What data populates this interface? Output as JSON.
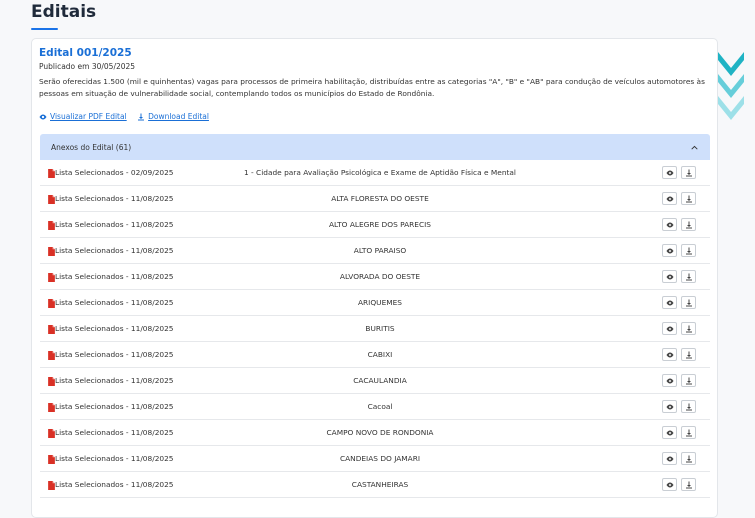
{
  "page": {
    "title": "Editais"
  },
  "edital": {
    "title": "Edital 001/2025",
    "published": "Publicado em 30/05/2025",
    "description": "Serão oferecidas 1.500 (mil e quinhentas) vagas para processos de primeira habilitação, distribuídas entre as categorias \"A\", \"B\" e \"AB\" para condução de veículos automotores às pessoas em situação de vulnerabilidade social, contemplando todos os municípios do Estado de Rondônia.",
    "view_pdf_label": "Visualizar PDF Edital",
    "download_label": "Download Edital"
  },
  "annexes": {
    "header": "Anexos do Edital (61)",
    "rows": [
      {
        "name": "Lista Selecionados - 02/09/2025",
        "desc": "1 - Cidade para Avaliação Psicológica e Exame de Aptidão Física e Mental"
      },
      {
        "name": "Lista Selecionados - 11/08/2025",
        "desc": "ALTA FLORESTA DO OESTE"
      },
      {
        "name": "Lista Selecionados - 11/08/2025",
        "desc": "ALTO ALEGRE DOS PARECIS"
      },
      {
        "name": "Lista Selecionados - 11/08/2025",
        "desc": "ALTO PARAISO"
      },
      {
        "name": "Lista Selecionados - 11/08/2025",
        "desc": "ALVORADA DO OESTE"
      },
      {
        "name": "Lista Selecionados - 11/08/2025",
        "desc": "ARIQUEMES"
      },
      {
        "name": "Lista Selecionados - 11/08/2025",
        "desc": "BURITIS"
      },
      {
        "name": "Lista Selecionados - 11/08/2025",
        "desc": "CABIXI"
      },
      {
        "name": "Lista Selecionados - 11/08/2025",
        "desc": "CACAULANDIA"
      },
      {
        "name": "Lista Selecionados - 11/08/2025",
        "desc": "Cacoal"
      },
      {
        "name": "Lista Selecionados - 11/08/2025",
        "desc": "CAMPO NOVO DE RONDONIA"
      },
      {
        "name": "Lista Selecionados - 11/08/2025",
        "desc": "CANDEIAS DO JAMARI"
      },
      {
        "name": "Lista Selecionados - 11/08/2025",
        "desc": "CASTANHEIRAS"
      }
    ]
  },
  "colors": {
    "accent": "#1a6fd6",
    "accordion_bg": "#cfe0fb",
    "pdf_red": "#d93025",
    "chevron_teal": "#1fb3c4"
  },
  "icons": {
    "view": "eye-icon",
    "download": "download-icon",
    "collapse": "chevron-up-icon",
    "file": "pdf-file-icon"
  }
}
